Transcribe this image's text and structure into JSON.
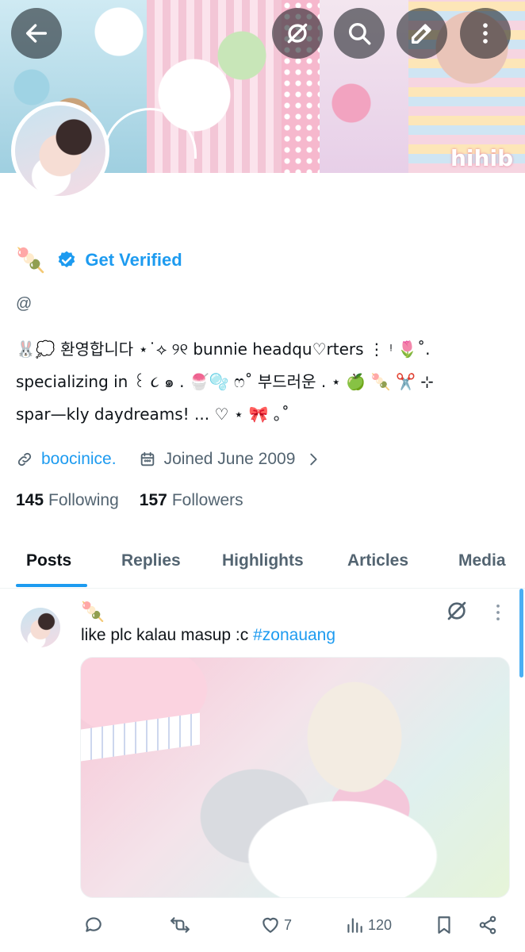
{
  "header": {
    "back_icon": "arrow-left-icon",
    "grok_icon": "slashed-circle-icon",
    "search_icon": "search-icon",
    "edit_icon": "pencil-icon",
    "more_icon": "kebab-menu-icon",
    "banner_text": "hihib"
  },
  "profile": {
    "name_emoji": "🍡",
    "verify_label": "Get Verified",
    "handle": "@",
    "bio_lines": [
      "🐰💭 환영합니다 ⋆˙⟡ ୨୧ bunnie headqu♡rters ⋮ ᵎ 🌷˚.",
      "specializing in ꒰ ૮ ๑ . 🍧🫧 ෆ˚ 부드러운 . ⋆ 🍏 🍡 ✂️ ⊹",
      "spar—kly daydreams! ... ♡ ⋆ 🎀 ｡˚"
    ],
    "website": "boocinice.",
    "joined": "Joined June 2009",
    "following_count": "145",
    "following_label": "Following",
    "followers_count": "157",
    "followers_label": "Followers",
    "colors": {
      "accent": "#1d9bf0",
      "text": "#0f1419",
      "muted": "#536471"
    }
  },
  "tabs": [
    {
      "label": "Posts",
      "active": true
    },
    {
      "label": "Replies",
      "active": false
    },
    {
      "label": "Highlights",
      "active": false
    },
    {
      "label": "Articles",
      "active": false
    },
    {
      "label": "Media",
      "active": false
    }
  ],
  "post": {
    "author_emoji": "🍡",
    "text": "like plc kalau masup :c ",
    "hashtag": "#zonauang",
    "actions": {
      "reply_icon": "speech-bubble-icon",
      "repost_icon": "repost-arrows-icon",
      "like_icon": "heart-icon",
      "like_count": "7",
      "views_icon": "bar-chart-icon",
      "views_count": "120",
      "bookmark_icon": "bookmark-icon",
      "share_icon": "share-icon"
    }
  }
}
